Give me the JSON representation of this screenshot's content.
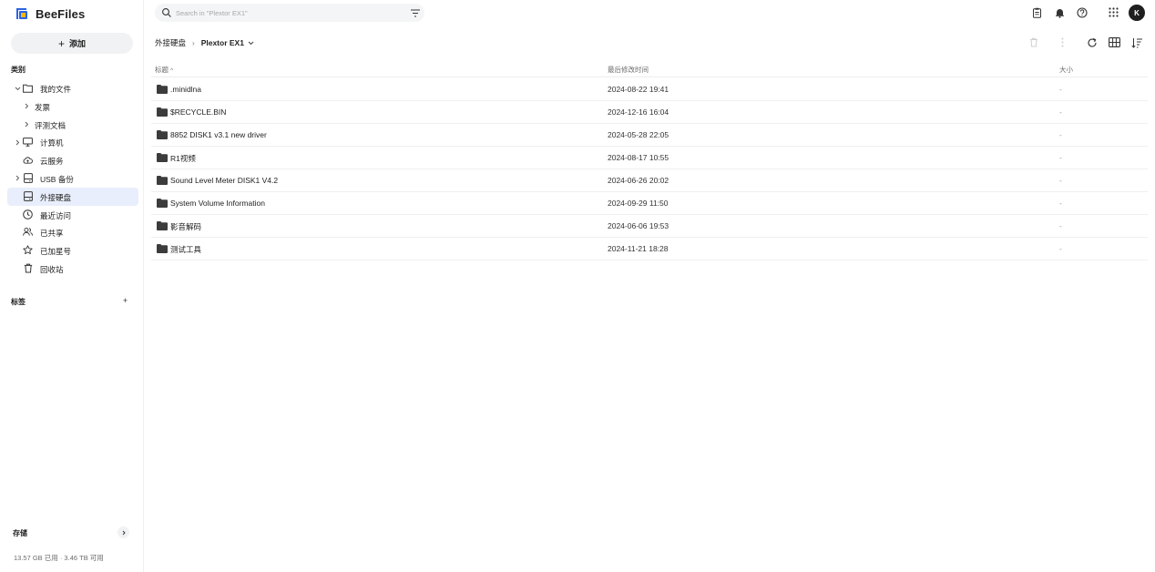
{
  "app": {
    "name": "BeeFiles"
  },
  "sidebar": {
    "add_label": "添加",
    "section_categories": "类别",
    "items": [
      {
        "label": "我的文件",
        "chevron": "down",
        "icon": "folder-icon",
        "indent": 0
      },
      {
        "label": "发票",
        "chevron": "right",
        "icon": "",
        "indent": 1
      },
      {
        "label": "评测文档",
        "chevron": "right",
        "icon": "",
        "indent": 1
      },
      {
        "label": "计算机",
        "chevron": "right",
        "icon": "monitor-icon",
        "indent": 0
      },
      {
        "label": "云服务",
        "chevron": "",
        "icon": "cloud-icon",
        "indent": 0
      },
      {
        "label": "USB 备份",
        "chevron": "right",
        "icon": "hard-drive-icon",
        "indent": 0
      },
      {
        "label": "外接硬盘",
        "chevron": "",
        "icon": "external-drive-icon",
        "indent": 0,
        "active": true
      },
      {
        "label": "最近访问",
        "chevron": "",
        "icon": "clock-icon",
        "indent": 0
      },
      {
        "label": "已共享",
        "chevron": "",
        "icon": "users-icon",
        "indent": 0
      },
      {
        "label": "已加星号",
        "chevron": "",
        "icon": "star-icon",
        "indent": 0
      },
      {
        "label": "回收站",
        "chevron": "",
        "icon": "trash-icon",
        "indent": 0
      }
    ],
    "section_tags": "标签",
    "storage_label": "存储",
    "storage_info": "13.57 GB 已用 · 3.46 TB 可用"
  },
  "search": {
    "placeholder": "Search in \"Plextor EX1\""
  },
  "breadcrumb": {
    "parent": "外接硬盘",
    "current": "Plextor EX1"
  },
  "table": {
    "columns": {
      "name": "标题",
      "modified": "最后修改时间",
      "size": "大小"
    },
    "rows": [
      {
        "name": ".minidlna",
        "modified": "2024-08-22 19:41",
        "size": "-"
      },
      {
        "name": "$RECYCLE.BIN",
        "modified": "2024-12-16 16:04",
        "size": "-"
      },
      {
        "name": "8852 DISK1 v3.1 new driver",
        "modified": "2024-05-28 22:05",
        "size": "-"
      },
      {
        "name": "R1视频",
        "modified": "2024-08-17 10:55",
        "size": "-"
      },
      {
        "name": "Sound Level Meter DISK1 V4.2",
        "modified": "2024-06-26 20:02",
        "size": "-"
      },
      {
        "name": "System Volume Information",
        "modified": "2024-09-29 11:50",
        "size": "-"
      },
      {
        "name": "影音解码",
        "modified": "2024-06-06 19:53",
        "size": "-"
      },
      {
        "name": "测试工具",
        "modified": "2024-11-21 18:28",
        "size": "-"
      }
    ]
  },
  "user": {
    "initial": "K"
  },
  "colors": {
    "accent": "#2b64e3",
    "active_bg": "#e8eefb",
    "logo_yellow": "#f5b800"
  }
}
